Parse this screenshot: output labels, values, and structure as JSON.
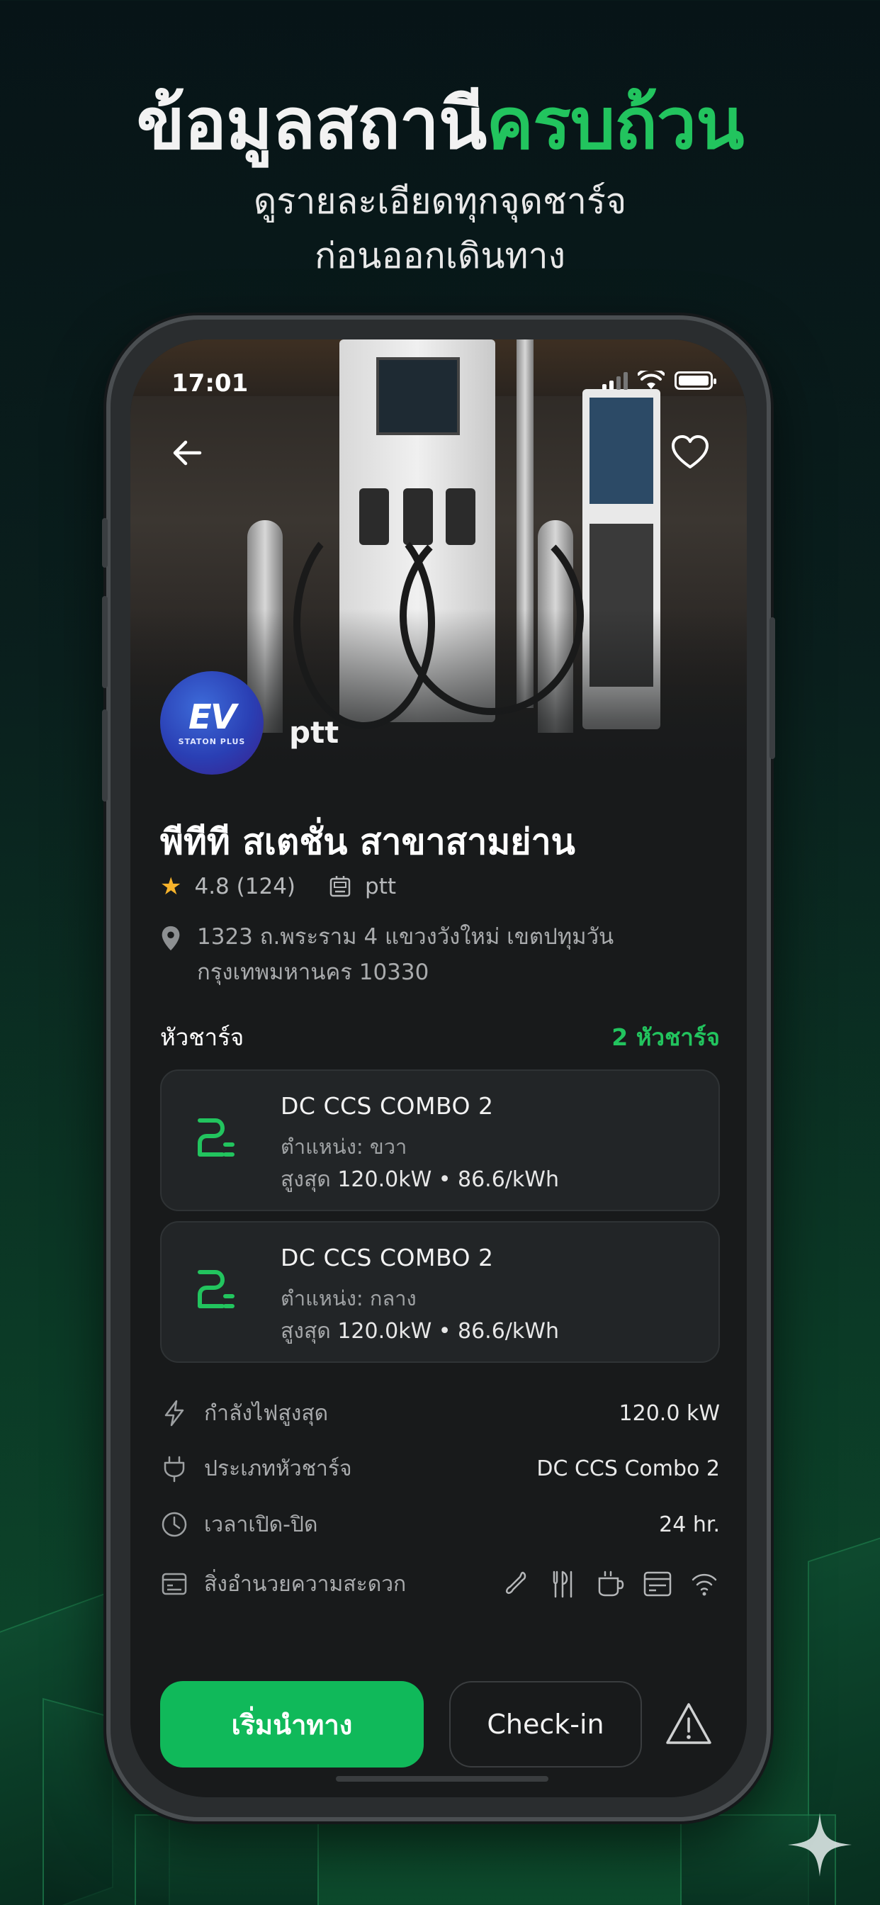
{
  "headline": {
    "part_white": "ข้อมูลสถานี",
    "part_green": "ครบถ้วน"
  },
  "subheadline": {
    "line1": "ดูรายละเอียดทุกจุดชาร์จ",
    "line2": "ก่อนออกเดินทาง"
  },
  "status_bar": {
    "time": "17:01"
  },
  "station": {
    "logo_text": "EV",
    "logo_brand": "STATON PLUS",
    "operator": "ptt",
    "name": "พีทีที สเตชั่น สาขาสามย่าน",
    "rating": "4.8",
    "reviews": "(124)",
    "operator_label": "ptt",
    "address_line1": "1323 ถ.พระราม 4 แขวงวังใหม่ เขตปทุมวัน",
    "address_line2": "กรุงเทพมหานคร 10330"
  },
  "connectors_section": {
    "label": "หัวชาร์จ",
    "count": "2 หัวชาร์จ"
  },
  "connectors": [
    {
      "name": "DC CCS COMBO 2",
      "position": "ตำแหน่ง: ขวา",
      "max_label": "สูงสุด",
      "spec": "120.0kW • 86.6/kWh"
    },
    {
      "name": "DC CCS COMBO 2",
      "position": "ตำแหน่ง: กลาง",
      "max_label": "สูงสุด",
      "spec": "120.0kW • 86.6/kWh"
    }
  ],
  "details": {
    "max_power": {
      "label": "กำลังไฟสูงสุด",
      "value": "120.0 kW"
    },
    "connector_type": {
      "label": "ประเภทหัวชาร์จ",
      "value": "DC CCS Combo 2"
    },
    "hours": {
      "label": "เวลาเปิด-ปิด",
      "value": "24 hr."
    },
    "amenities": {
      "label": "สิ่งอำนวยความสะดวก",
      "icons": [
        "toilet-icon",
        "restaurant-icon",
        "coffee-icon",
        "atm-icon",
        "wifi-icon"
      ]
    }
  },
  "actions": {
    "start": "เริ่มนำทาง",
    "checkin": "Check-in"
  },
  "colors": {
    "accent": "#22c45e",
    "button": "#10b95a",
    "card": "#222527",
    "screen_bg": "#181a1b"
  }
}
